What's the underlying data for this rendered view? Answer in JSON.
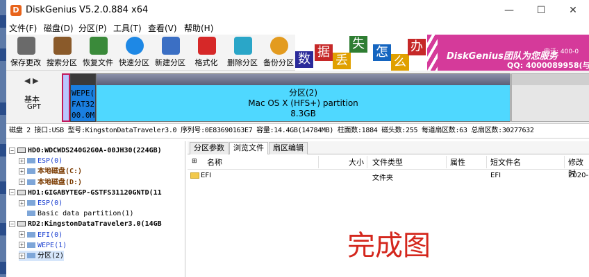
{
  "window": {
    "app_icon_glyph": "D",
    "title": "DiskGenius V5.2.0.884 x64",
    "controls": [
      "—",
      "☐",
      "✕"
    ]
  },
  "menu": [
    "文件(F)",
    "磁盘(D)",
    "分区(P)",
    "工具(T)",
    "查看(V)",
    "帮助(H)"
  ],
  "toolbar": [
    {
      "label": "保存更改",
      "icon": "save-icon",
      "color": "#6a6a6a"
    },
    {
      "label": "搜索分区",
      "icon": "magnifier-icon",
      "color": "#8a5a2a"
    },
    {
      "label": "恢复文件",
      "icon": "recover-box-icon",
      "color": "#3a8a3a"
    },
    {
      "label": "快速分区",
      "icon": "quick-partition-disc-icon",
      "color": "#1e88e5"
    },
    {
      "label": "新建分区",
      "icon": "new-partition-icon",
      "color": "#3b6fc4"
    },
    {
      "label": "格式化",
      "icon": "format-icon",
      "color": "#d62828"
    },
    {
      "label": "删除分区",
      "icon": "trash-icon",
      "color": "#2aa6c8"
    },
    {
      "label": "备份分区",
      "icon": "backup-disc-icon",
      "color": "#e39b1f"
    }
  ],
  "banner": {
    "tiles": [
      {
        "char": "数",
        "bg": "#2a2a9a"
      },
      {
        "char": "据",
        "bg": "#c62828"
      },
      {
        "char": "丢",
        "bg": "#e0a000"
      },
      {
        "char": "失",
        "bg": "#2e7d32"
      },
      {
        "char": "怎",
        "bg": "#1565c0"
      },
      {
        "char": "么",
        "bg": "#e0a000"
      },
      {
        "char": "办",
        "bg": "#c62828"
      }
    ],
    "slogan": "DiskGenius团队为您服务",
    "phone_prefix": "电话: 400-0",
    "qq": "QQ: 4000089958(与"
  },
  "disk_map": {
    "nav_left": "◀",
    "nav_right": "▶",
    "mode_line1": "基本",
    "mode_line2": "GPT",
    "small_partition": [
      "WEPE(",
      "FAT32",
      "00.0M"
    ],
    "main_partition": {
      "name": "分区(2)",
      "fs": "Mac OS X (HFS+) partition",
      "size": "8.3GB"
    }
  },
  "disk_info": "磁盘 2 接口:USB  型号:KingstonDataTraveler3.0  序列号:0E83690163E7  容量:14.4GB(14784MB)  柱面数:1884  磁头数:255  每道扇区数:63  总扇区数:30277632",
  "tree": [
    {
      "indent": 4,
      "expander": "−",
      "icon": "disk",
      "text": "HD0:WDCWDS240G2G0A-00JH30(224GB)",
      "color": "bold"
    },
    {
      "indent": 18,
      "expander": "+",
      "icon": "part",
      "text": "ESP(0)",
      "color": "blue"
    },
    {
      "indent": 18,
      "expander": "+",
      "icon": "part",
      "text": "本地磁盘(C:)",
      "color": "brown"
    },
    {
      "indent": 18,
      "expander": "+",
      "icon": "part",
      "text": "本地磁盘(D:)",
      "color": "brown"
    },
    {
      "indent": 4,
      "expander": "−",
      "icon": "disk",
      "text": "HD1:GIGABYTEGP-GSTFS31120GNTD(11",
      "color": "bold"
    },
    {
      "indent": 18,
      "expander": "+",
      "icon": "part",
      "text": "ESP(0)",
      "color": "blue"
    },
    {
      "indent": 18,
      "expander": "",
      "icon": "part",
      "text": "Basic data partition(1)",
      "color": "plain"
    },
    {
      "indent": 4,
      "expander": "−",
      "icon": "disk",
      "text": "RD2:KingstonDataTraveler3.0(14GB",
      "color": "bold"
    },
    {
      "indent": 18,
      "expander": "+",
      "icon": "part",
      "text": "EFI(0)",
      "color": "blue"
    },
    {
      "indent": 18,
      "expander": "+",
      "icon": "part",
      "text": "WEPE(1)",
      "color": "blue"
    },
    {
      "indent": 18,
      "expander": "+",
      "icon": "part",
      "text": "分区(2)",
      "color": "plain",
      "selected": true
    }
  ],
  "tabs": [
    "分区参数",
    "浏览文件",
    "扇区编辑"
  ],
  "active_tab": 1,
  "file_columns": [
    "名称",
    "大小",
    "文件类型",
    "属性",
    "短文件名",
    "修改时"
  ],
  "files": [
    {
      "name": "EFI",
      "size": "",
      "type": "文件夹",
      "attr": "",
      "short": "EFI",
      "modified": "2020-"
    }
  ],
  "overlay_text": "完成图",
  "colors": {
    "accent_red": "#d4271d",
    "partition_cyan": "#4fd8ff",
    "partition_blue": "#1a7fe0"
  }
}
